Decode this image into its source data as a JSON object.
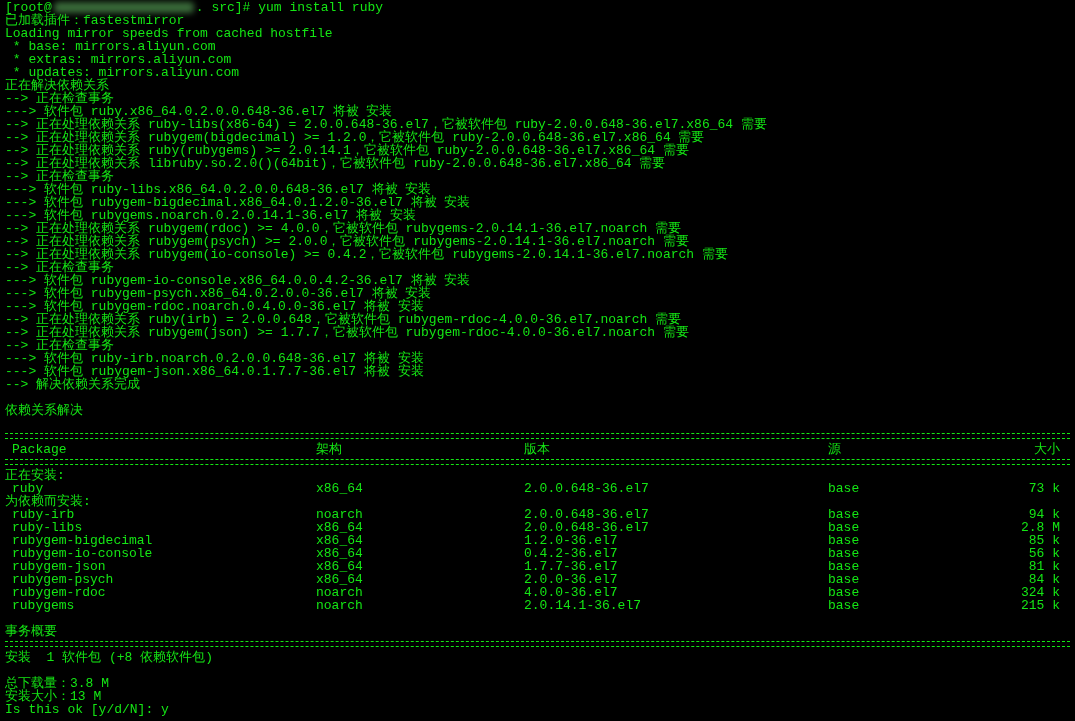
{
  "prompt_line": {
    "user": "[root@",
    "command": ". src]# yum install ruby"
  },
  "log_lines": [
    "已加载插件：fastestmirror",
    "Loading mirror speeds from cached hostfile",
    " * base: mirrors.aliyun.com",
    " * extras: mirrors.aliyun.com",
    " * updates: mirrors.aliyun.com",
    "正在解决依赖关系",
    "--> 正在检查事务",
    "---> 软件包 ruby.x86_64.0.2.0.0.648-36.el7 将被 安装",
    "--> 正在处理依赖关系 ruby-libs(x86-64) = 2.0.0.648-36.el7，它被软件包 ruby-2.0.0.648-36.el7.x86_64 需要",
    "--> 正在处理依赖关系 rubygem(bigdecimal) >= 1.2.0，它被软件包 ruby-2.0.0.648-36.el7.x86_64 需要",
    "--> 正在处理依赖关系 ruby(rubygems) >= 2.0.14.1，它被软件包 ruby-2.0.0.648-36.el7.x86_64 需要",
    "--> 正在处理依赖关系 libruby.so.2.0()(64bit)，它被软件包 ruby-2.0.0.648-36.el7.x86_64 需要",
    "--> 正在检查事务",
    "---> 软件包 ruby-libs.x86_64.0.2.0.0.648-36.el7 将被 安装",
    "---> 软件包 rubygem-bigdecimal.x86_64.0.1.2.0-36.el7 将被 安装",
    "---> 软件包 rubygems.noarch.0.2.0.14.1-36.el7 将被 安装",
    "--> 正在处理依赖关系 rubygem(rdoc) >= 4.0.0，它被软件包 rubygems-2.0.14.1-36.el7.noarch 需要",
    "--> 正在处理依赖关系 rubygem(psych) >= 2.0.0，它被软件包 rubygems-2.0.14.1-36.el7.noarch 需要",
    "--> 正在处理依赖关系 rubygem(io-console) >= 0.4.2，它被软件包 rubygems-2.0.14.1-36.el7.noarch 需要",
    "--> 正在检查事务",
    "---> 软件包 rubygem-io-console.x86_64.0.0.4.2-36.el7 将被 安装",
    "---> 软件包 rubygem-psych.x86_64.0.2.0.0-36.el7 将被 安装",
    "---> 软件包 rubygem-rdoc.noarch.0.4.0.0-36.el7 将被 安装",
    "--> 正在处理依赖关系 ruby(irb) = 2.0.0.648，它被软件包 rubygem-rdoc-4.0.0-36.el7.noarch 需要",
    "--> 正在处理依赖关系 rubygem(json) >= 1.7.7，它被软件包 rubygem-rdoc-4.0.0-36.el7.noarch 需要",
    "--> 正在检查事务",
    "---> 软件包 ruby-irb.noarch.0.2.0.0.648-36.el7 将被 安装",
    "---> 软件包 rubygem-json.x86_64.0.1.7.7-36.el7 将被 安装",
    "--> 解决依赖关系完成"
  ],
  "result": "依赖关系解决",
  "table": {
    "columns": [
      "Package",
      "架构",
      "版本",
      "源",
      "大小"
    ],
    "groups": [
      {
        "heading": "正在安装:",
        "rows": [
          [
            "ruby",
            "x86_64",
            "2.0.0.648-36.el7",
            "base",
            "73 k"
          ]
        ]
      },
      {
        "heading": "为依赖而安装:",
        "rows": [
          [
            "ruby-irb",
            "noarch",
            "2.0.0.648-36.el7",
            "base",
            "94 k"
          ],
          [
            "ruby-libs",
            "x86_64",
            "2.0.0.648-36.el7",
            "base",
            "2.8 M"
          ],
          [
            "rubygem-bigdecimal",
            "x86_64",
            "1.2.0-36.el7",
            "base",
            "85 k"
          ],
          [
            "rubygem-io-console",
            "x86_64",
            "0.4.2-36.el7",
            "base",
            "56 k"
          ],
          [
            "rubygem-json",
            "x86_64",
            "1.7.7-36.el7",
            "base",
            "81 k"
          ],
          [
            "rubygem-psych",
            "x86_64",
            "2.0.0-36.el7",
            "base",
            "84 k"
          ],
          [
            "rubygem-rdoc",
            "noarch",
            "4.0.0-36.el7",
            "base",
            "324 k"
          ],
          [
            "rubygems",
            "noarch",
            "2.0.14.1-36.el7",
            "base",
            "215 k"
          ]
        ]
      }
    ]
  },
  "summary": {
    "heading": "事务概要",
    "install_line": "安装  1 软件包 (+8 依赖软件包)",
    "download_size": "总下载量：3.8 M",
    "installed_size": "安装大小：13 M",
    "confirm_prompt": "Is this ok [y/d/N]: y"
  }
}
